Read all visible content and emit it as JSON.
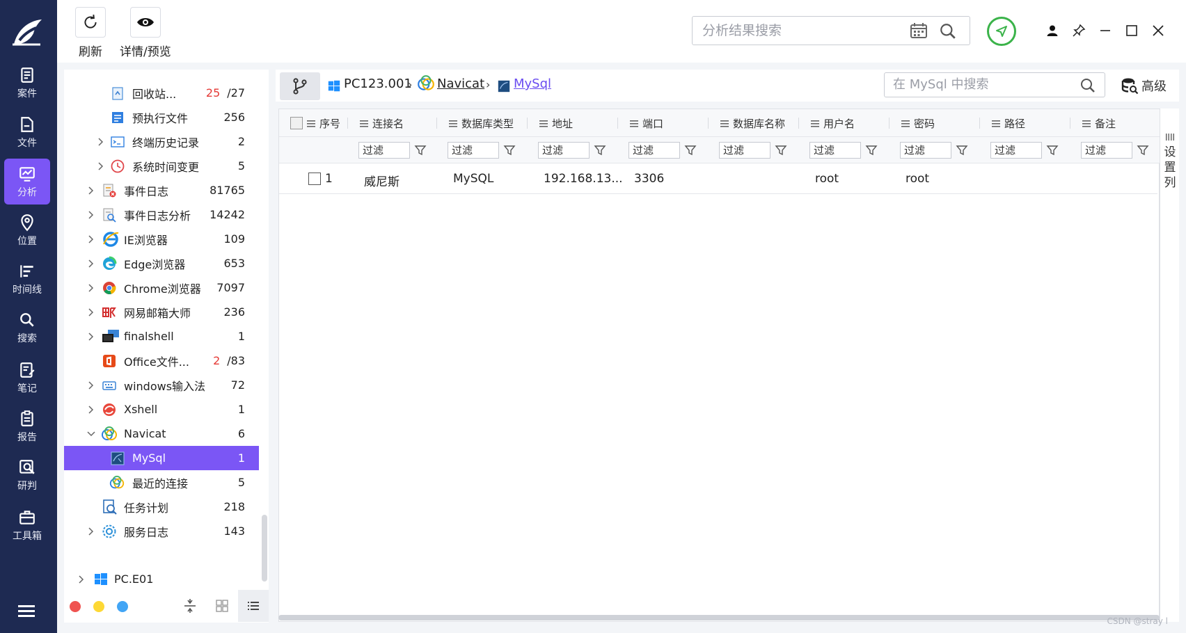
{
  "nav": {
    "items": [
      {
        "label": "案件",
        "icon": "case-icon"
      },
      {
        "label": "文件",
        "icon": "folder-icon"
      },
      {
        "label": "分析",
        "icon": "analysis-icon"
      },
      {
        "label": "位置",
        "icon": "location-icon"
      },
      {
        "label": "时间线",
        "icon": "timeline-icon"
      },
      {
        "label": "搜索",
        "icon": "search-icon"
      },
      {
        "label": "笔记",
        "icon": "note-icon"
      },
      {
        "label": "报告",
        "icon": "report-icon"
      },
      {
        "label": "研判",
        "icon": "judge-icon"
      },
      {
        "label": "工具箱",
        "icon": "toolbox-icon"
      }
    ],
    "active": "分析"
  },
  "toolbar": {
    "refresh_label": "刷新",
    "details_label": "详情/预览",
    "search_placeholder": "分析结果搜索"
  },
  "tree": {
    "items": [
      {
        "name": "回收站...",
        "count_red": "25",
        "count": "/27",
        "icon": "recycle-bin-icon"
      },
      {
        "name": "预执行文件",
        "count": "256",
        "icon": "prefetch-icon"
      },
      {
        "name": "终端历史记录",
        "count": "2",
        "icon": "terminal-icon"
      },
      {
        "name": "系统时间变更",
        "count": "5",
        "icon": "clock-icon"
      },
      {
        "name": "事件日志",
        "count": "81765",
        "icon": "event-log-icon"
      },
      {
        "name": "事件日志分析",
        "count": "14242",
        "icon": "event-analysis-icon"
      },
      {
        "name": "IE浏览器",
        "count": "109",
        "icon": "ie-icon"
      },
      {
        "name": "Edge浏览器",
        "count": "653",
        "icon": "edge-icon"
      },
      {
        "name": "Chrome浏览器",
        "count": "7097",
        "icon": "chrome-icon"
      },
      {
        "name": "网易邮箱大师",
        "count": "236",
        "icon": "mail-icon"
      },
      {
        "name": "finalshell",
        "count": "1",
        "icon": "finalshell-icon"
      },
      {
        "name": "Office文件...",
        "count_red": "2",
        "count": "/83",
        "icon": "office-icon"
      },
      {
        "name": "windows输入法",
        "count": "72",
        "icon": "keyboard-icon"
      },
      {
        "name": "Xshell",
        "count": "1",
        "icon": "xshell-icon"
      },
      {
        "name": "Navicat",
        "count": "6",
        "icon": "navicat-icon"
      },
      {
        "name": "MySql",
        "count": "1",
        "icon": "mysql-icon"
      },
      {
        "name": "最近的连接",
        "count": "5",
        "icon": "navicat-icon"
      },
      {
        "name": "任务计划",
        "count": "218",
        "icon": "task-icon"
      },
      {
        "name": "服务日志",
        "count": "143",
        "icon": "service-icon"
      }
    ],
    "root": "PC.E01"
  },
  "breadcrumb": {
    "device": "PC123.001",
    "app": "Navicat",
    "current": "MySql"
  },
  "main_search": {
    "placeholder": "在 MySql 中搜索"
  },
  "advanced_label": "高级",
  "table": {
    "columns": [
      "序号",
      "连接名",
      "数据库类型",
      "地址",
      "端口",
      "数据库名称",
      "用户名",
      "密码",
      "路径",
      "备注"
    ],
    "filter_placeholder": "过滤",
    "rows": [
      {
        "index": "1",
        "conn": "威尼斯",
        "dbtype": "MySQL",
        "addr": "192.168.13...",
        "port": "3306",
        "dbname": "",
        "user": "root",
        "pass": "root",
        "path": "",
        "note": ""
      }
    ]
  },
  "settings_col_label": "设置列",
  "watermark": "CSDN @stray l"
}
